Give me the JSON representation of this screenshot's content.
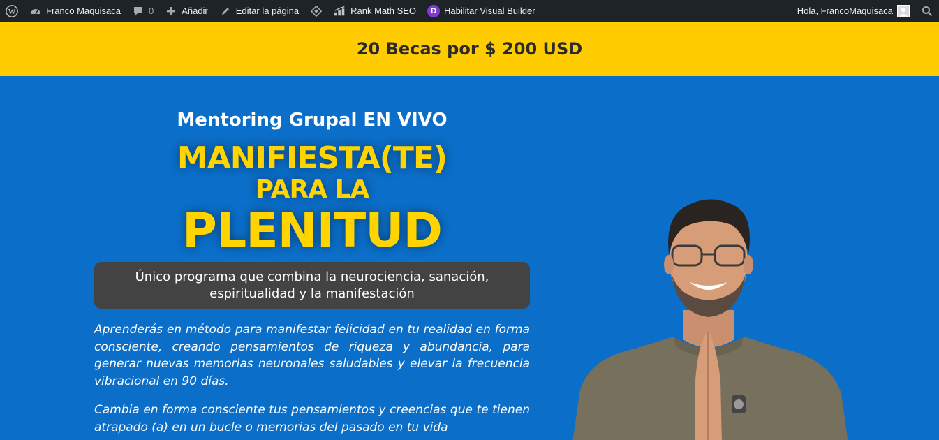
{
  "adminbar": {
    "site_name": "Franco Maquisaca",
    "comments_count": "0",
    "add_label": "Añadir",
    "edit_label": "Editar la página",
    "rankmath_label": "Rank Math SEO",
    "visual_builder_label": "Habilitar Visual Builder",
    "greeting": "Hola, FrancoMaquisaca",
    "icons": [
      "wordpress-icon",
      "dashboard-icon",
      "comment-icon",
      "plus-icon",
      "pencil-icon",
      "diamond-icon",
      "rank-math-icon",
      "divi-icon",
      "avatar",
      "search-icon"
    ]
  },
  "banner": {
    "text": "20 Becas por $ 200 USD",
    "color": "#ffcc00"
  },
  "hero": {
    "background": "#0b6ec8",
    "subtitle": "Mentoring Grupal EN VIVO",
    "headline_line1": "MANIFIESTA(TE)",
    "headline_line2": "PARA LA",
    "headline_line3": "PLENITUD",
    "headline_color": "#ffd400",
    "pill_text": "Único programa que combina la neurociencia, sanación, espiritualidad y la manifestación",
    "paragraph1": "Aprenderás en método para manifestar felicidad en tu realidad en forma consciente, creando pensamientos de riqueza y abundancia, para generar nuevas memorias neuronales saludables y elevar la frecuencia vibracional en 90 días.",
    "paragraph2": "Cambia en forma consciente tus pensamientos y creencias que te tienen atrapado (a) en un bucle o memorias del pasado en tu vida"
  }
}
